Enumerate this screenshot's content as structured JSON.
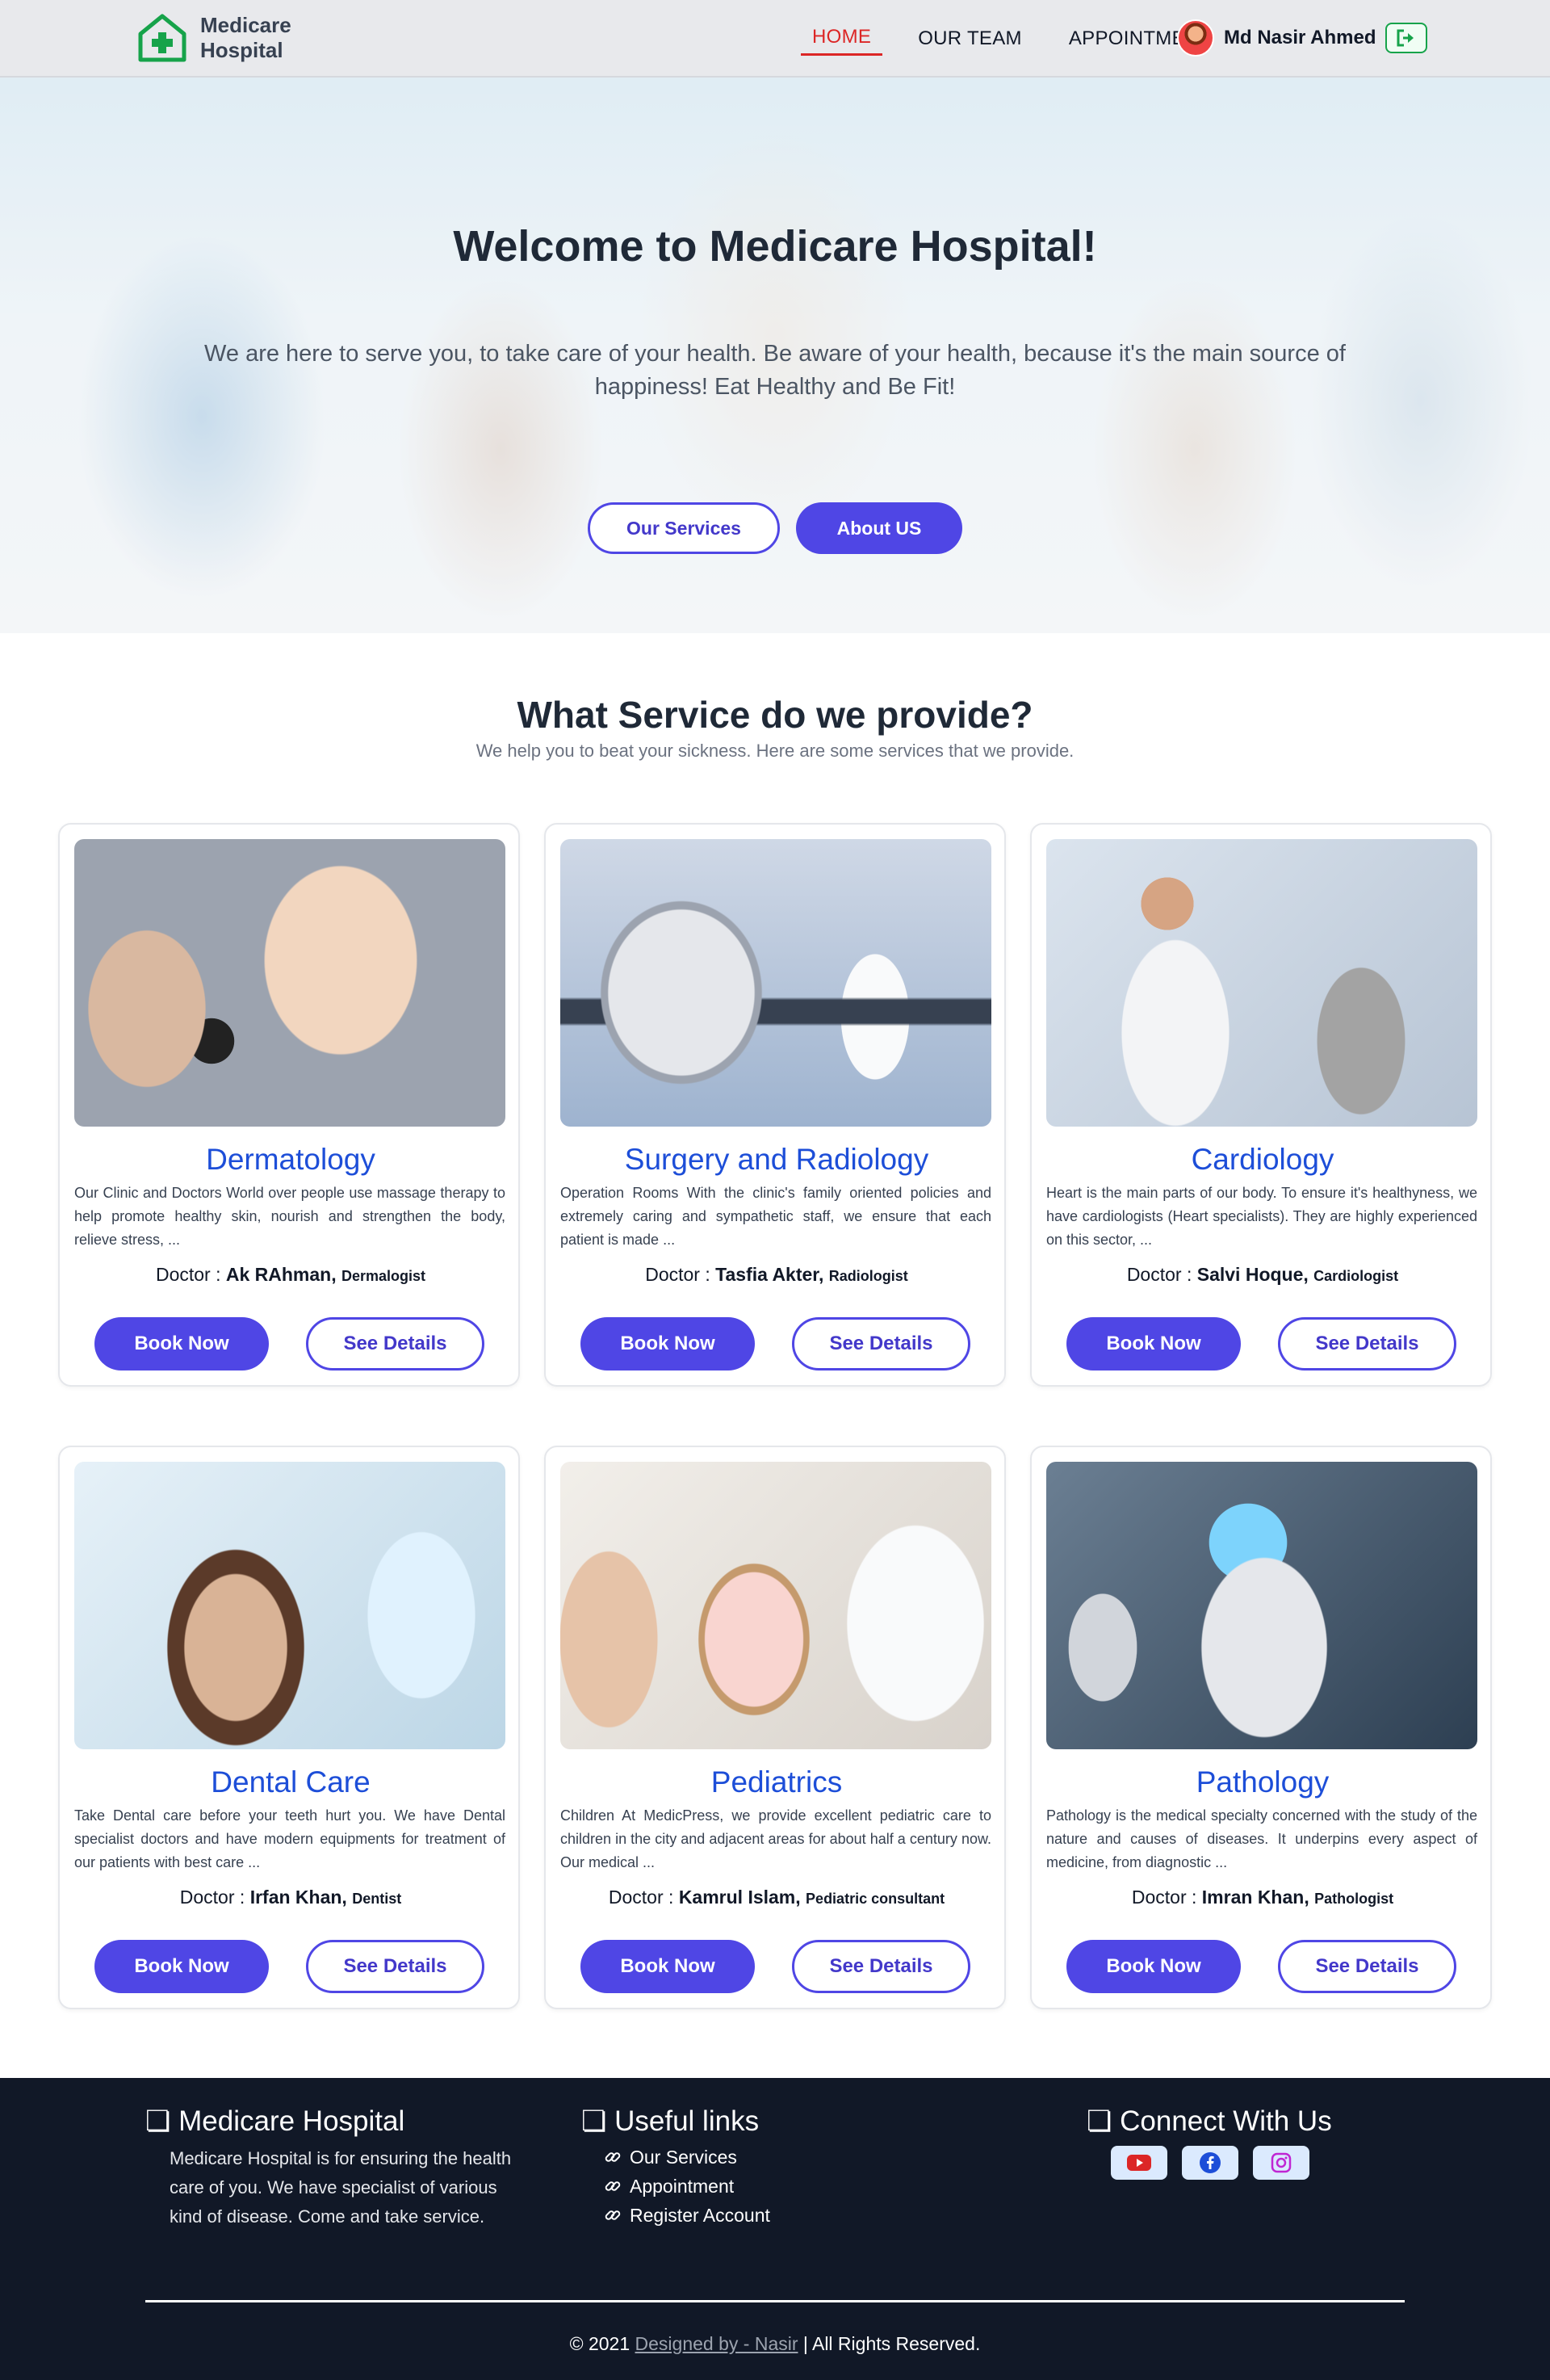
{
  "brand": {
    "line1": "Medicare",
    "line2": "Hospital",
    "accent": "#16a34a"
  },
  "nav": {
    "items": [
      {
        "label": "HOME",
        "active": true
      },
      {
        "label": "OUR TEAM",
        "active": false
      },
      {
        "label": "APPOINTMENT",
        "active": false
      }
    ],
    "user_name": "Md Nasir Ahmed"
  },
  "hero": {
    "title": "Welcome to Medicare Hospital!",
    "text": "We are here to serve you, to take care of your health. Be aware of your health, because it's the main source of happiness! Eat Healthy and Be Fit!",
    "btn_services": "Our Services",
    "btn_about": "About US"
  },
  "services": {
    "title": "What Service do we provide?",
    "subtitle": "We help you to beat your sickness. Here are some services that we provide.",
    "book_label": "Book Now",
    "details_label": "See Details",
    "doctor_prefix": "Doctor : ",
    "items": [
      {
        "title": "Dermatology",
        "desc": "Our Clinic and Doctors World over people use massage therapy to help promote healthy skin, nourish and strengthen the body, relieve stress, ...",
        "doctor": "Ak RAhman,",
        "specialty": "Dermalogist"
      },
      {
        "title": "Surgery and Radiology",
        "desc": "Operation Rooms With the clinic's family oriented policies and extremely caring and sympathetic staff, we ensure that each patient is made ...",
        "doctor": "Tasfia Akter,",
        "specialty": "Radiologist"
      },
      {
        "title": "Cardiology",
        "desc": "Heart is the main parts of our body. To ensure it's healthyness, we have cardiologists (Heart specialists). They are highly experienced on this sector, ...",
        "doctor": "Salvi Hoque,",
        "specialty": "Cardiologist"
      },
      {
        "title": "Dental Care",
        "desc": "Take Dental care before your teeth hurt you. We have Dental specialist doctors and have modern equipments for treatment of our patients with best care ...",
        "doctor": "Irfan Khan,",
        "specialty": "Dentist"
      },
      {
        "title": "Pediatrics",
        "desc": "Children At MedicPress, we provide excellent pediatric care to children in the city and adjacent areas for about half a century now. Our medical ...",
        "doctor": "Kamrul Islam,",
        "specialty": "Pediatric consultant"
      },
      {
        "title": "Pathology",
        "desc": "Pathology is the medical specialty concerned with the study of the nature and causes of diseases. It underpins every aspect of medicine, from diagnostic ...",
        "doctor": "Imran Khan,",
        "specialty": "Pathologist"
      }
    ]
  },
  "footer": {
    "about_title": "Medicare Hospital",
    "about_text": "Medicare Hospital is for ensuring the health care of you. We have specialist of various kind of disease. Come and take service.",
    "links_title": "Useful links",
    "links": [
      "Our Services",
      "Appointment",
      "Register Account"
    ],
    "connect_title": "Connect With Us",
    "social": [
      "youtube-icon",
      "facebook-icon",
      "instagram-icon"
    ],
    "copy_prefix": "© 2021 ",
    "copy_link": "Designed by - Nasir",
    "copy_suffix": " | All Rights Reserved."
  },
  "colors": {
    "primary": "#4f46e5",
    "title_blue": "#1d4ed8",
    "nav_active": "#dc2626",
    "footer_bg": "#111827"
  }
}
